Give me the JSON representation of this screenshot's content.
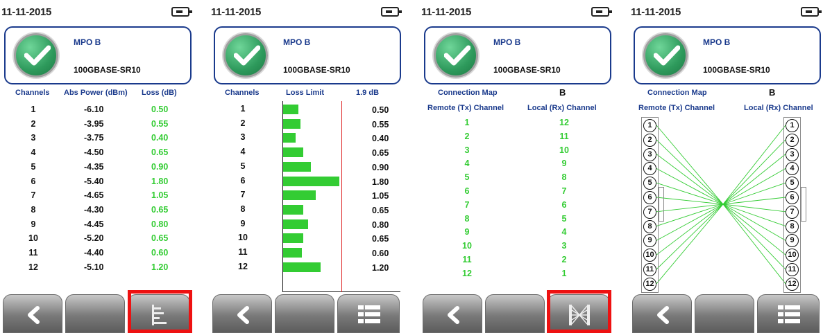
{
  "date": "11-11-2015",
  "card": {
    "title": "MPO B",
    "subtitle": "100GBASE-SR10"
  },
  "panel1": {
    "headers": {
      "channels": "Channels",
      "abs_power": "Abs Power (dBm)",
      "loss": "Loss (dB)"
    },
    "rows": [
      {
        "ch": "1",
        "power": "-6.10",
        "loss": "0.50"
      },
      {
        "ch": "2",
        "power": "-3.95",
        "loss": "0.55"
      },
      {
        "ch": "3",
        "power": "-3.75",
        "loss": "0.40"
      },
      {
        "ch": "4",
        "power": "-4.50",
        "loss": "0.65"
      },
      {
        "ch": "5",
        "power": "-4.35",
        "loss": "0.90"
      },
      {
        "ch": "6",
        "power": "-5.40",
        "loss": "1.80"
      },
      {
        "ch": "7",
        "power": "-4.65",
        "loss": "1.05"
      },
      {
        "ch": "8",
        "power": "-4.30",
        "loss": "0.65"
      },
      {
        "ch": "9",
        "power": "-4.45",
        "loss": "0.80"
      },
      {
        "ch": "10",
        "power": "-5.20",
        "loss": "0.65"
      },
      {
        "ch": "11",
        "power": "-4.40",
        "loss": "0.60"
      },
      {
        "ch": "12",
        "power": "-5.10",
        "loss": "1.20"
      }
    ]
  },
  "panel2": {
    "headers": {
      "channels": "Channels",
      "loss_limit": "Loss Limit",
      "limit_value": "1.9 dB"
    }
  },
  "chart_data": {
    "type": "bar",
    "orientation": "horizontal",
    "categories": [
      "1",
      "2",
      "3",
      "4",
      "5",
      "6",
      "7",
      "8",
      "9",
      "10",
      "11",
      "12"
    ],
    "values": [
      0.5,
      0.55,
      0.4,
      0.65,
      0.9,
      1.8,
      1.05,
      0.65,
      0.8,
      0.65,
      0.6,
      1.2
    ],
    "value_labels": [
      "0.50",
      "0.55",
      "0.40",
      "0.65",
      "0.90",
      "1.80",
      "1.05",
      "0.65",
      "0.80",
      "0.65",
      "0.60",
      "1.20"
    ],
    "limit": 1.9,
    "xlim": [
      0,
      1.9
    ],
    "bar_color": "#33cc33",
    "limit_color": "#dd2222"
  },
  "panel3": {
    "headers": {
      "map": "Connection Map",
      "map_value": "B",
      "remote": "Remote (Tx) Channel",
      "local": "Local (Rx) Channel"
    },
    "pairs": [
      {
        "remote": "1",
        "local": "12"
      },
      {
        "remote": "2",
        "local": "11"
      },
      {
        "remote": "3",
        "local": "10"
      },
      {
        "remote": "4",
        "local": "9"
      },
      {
        "remote": "5",
        "local": "8"
      },
      {
        "remote": "6",
        "local": "7"
      },
      {
        "remote": "7",
        "local": "6"
      },
      {
        "remote": "8",
        "local": "5"
      },
      {
        "remote": "9",
        "local": "4"
      },
      {
        "remote": "10",
        "local": "3"
      },
      {
        "remote": "11",
        "local": "2"
      },
      {
        "remote": "12",
        "local": "1"
      }
    ]
  },
  "panel4": {
    "headers": {
      "map": "Connection Map",
      "map_value": "B",
      "remote": "Remote (Tx) Channel",
      "local": "Local (Rx) Channel"
    },
    "left_pins": [
      "1",
      "2",
      "3",
      "4",
      "5",
      "6",
      "7",
      "8",
      "9",
      "10",
      "11",
      "12"
    ],
    "right_pins": [
      "1",
      "2",
      "3",
      "4",
      "5",
      "6",
      "7",
      "8",
      "9",
      "10",
      "11",
      "12"
    ]
  },
  "icons": {
    "back": "chevron-left-icon",
    "table_view": "table-view-icon",
    "bar_view": "bar-chart-view-icon",
    "list_view": "list-view-icon",
    "map_view": "connection-map-view-icon",
    "battery": "battery-plug-icon",
    "pass": "check-pass-icon"
  },
  "colors": {
    "accent": "#1a3a8c",
    "pass_green": "#33cc33",
    "highlight": "#ee1111"
  }
}
